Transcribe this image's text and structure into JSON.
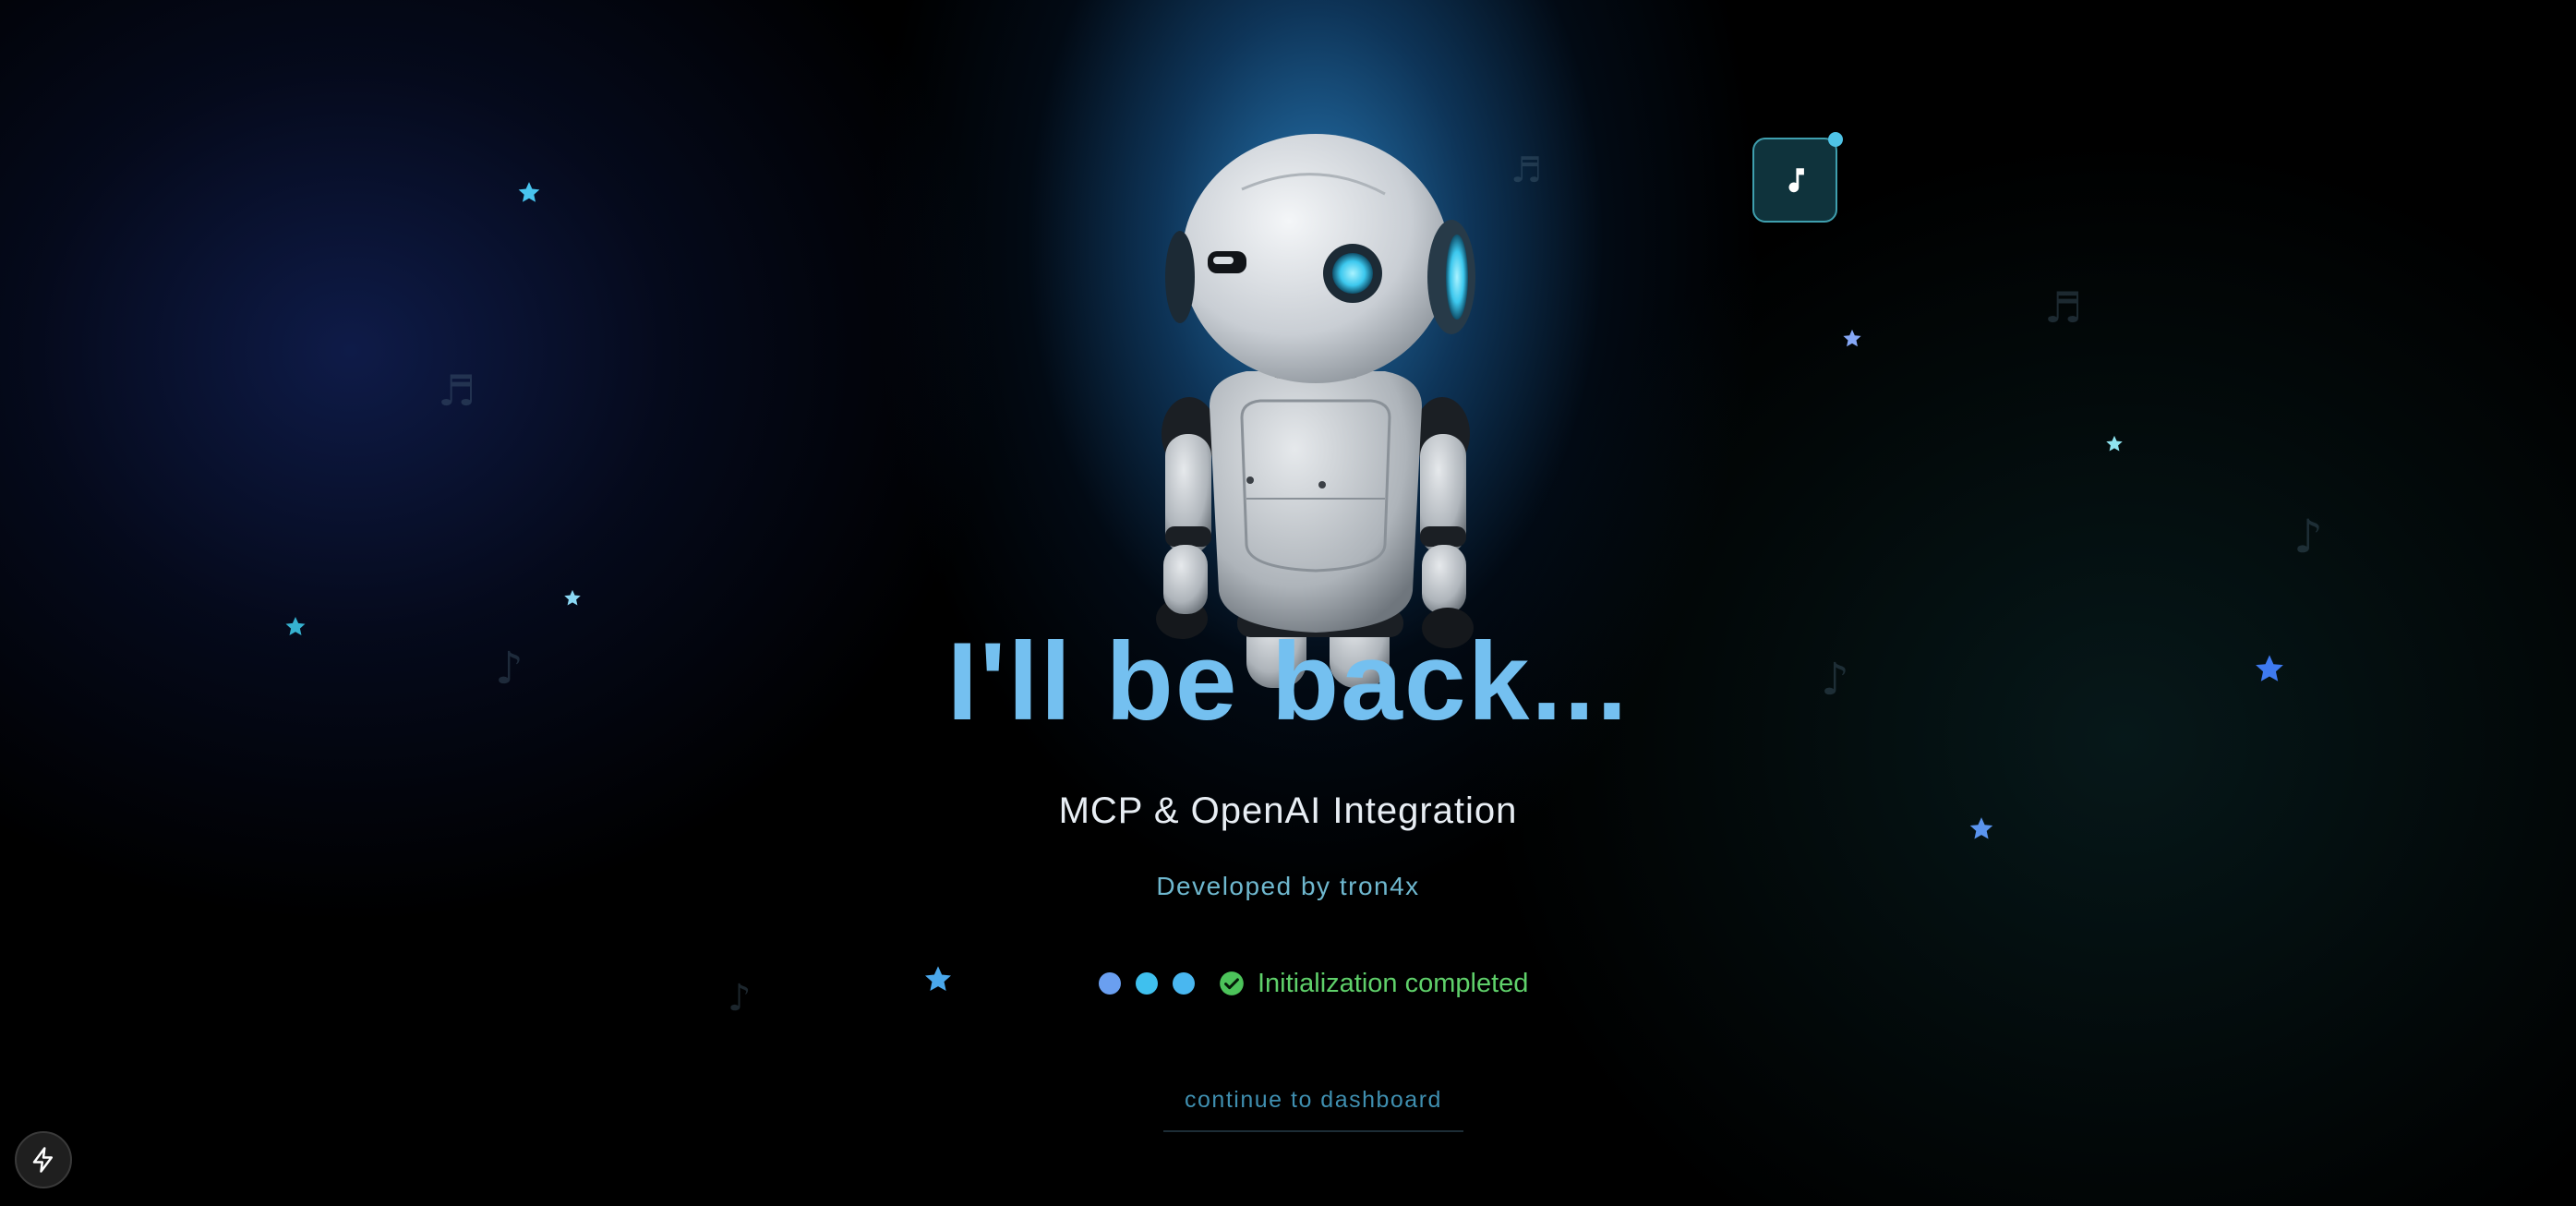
{
  "headline": "I'll be back...",
  "subtitle": "MCP & OpenAI Integration",
  "developer": "Developed by tron4x",
  "status": {
    "text": "Initialization completed",
    "dots": [
      "#6a9ff0",
      "#3fc0ee",
      "#49b7f0"
    ],
    "color": "#5fd06a"
  },
  "continue_link": "continue to dashboard",
  "colors": {
    "accent": "#74c0f0",
    "success": "#5fd06a",
    "link": "#3f8fb0"
  },
  "icons": {
    "music_toggle": "music-note-icon",
    "dev_indicator": "lightning-bolt-icon",
    "status": "check-circle-icon"
  }
}
